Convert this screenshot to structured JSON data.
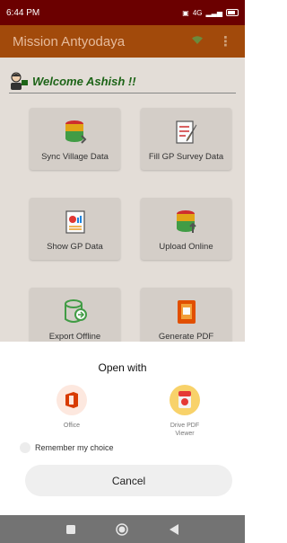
{
  "status_bar": {
    "time": "6:44 PM",
    "network": "4G",
    "battery_icon": "battery-icon"
  },
  "app_bar": {
    "title": "Mission Antyodaya",
    "wifi_icon": "wifi-icon",
    "more_icon": "more-vert-icon"
  },
  "welcome": {
    "text": "Welcome Ashish !!"
  },
  "tiles": [
    {
      "label": "Sync Village Data",
      "icon": "database-sync-icon"
    },
    {
      "label": "Fill GP Survey Data",
      "icon": "form-edit-icon"
    },
    {
      "label": "Show GP Data",
      "icon": "report-chart-icon"
    },
    {
      "label": "Upload Online",
      "icon": "database-upload-icon"
    },
    {
      "label": "Export Offline",
      "icon": "database-export-icon"
    },
    {
      "label": "Generate PDF",
      "icon": "pdf-book-icon"
    }
  ],
  "sheet": {
    "title": "Open with",
    "apps": [
      {
        "name": "Office",
        "icon": "office-icon",
        "color": "#d83b01"
      },
      {
        "name": "Drive PDF Viewer",
        "icon": "drive-pdf-icon",
        "color": "#f4b400"
      }
    ],
    "remember_label": "Remember my choice",
    "cancel_label": "Cancel"
  },
  "colors": {
    "status": "#6b0000",
    "app_bar": "#a24a0b",
    "accent_green": "#1e6618"
  }
}
